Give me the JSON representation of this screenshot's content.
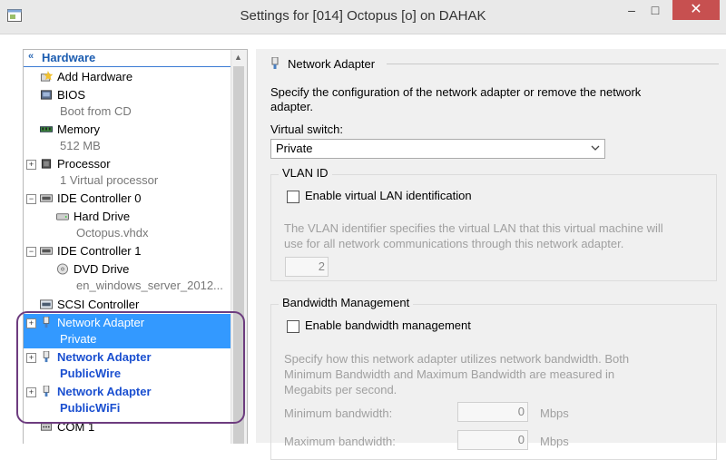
{
  "window": {
    "title": "Settings for [014] Octopus [o] on DAHAK",
    "minimize": "–",
    "maximize": "□",
    "close": "✕"
  },
  "tree": {
    "section_label": "Hardware",
    "items": [
      {
        "name": "Add Hardware",
        "sub": "",
        "icon": "add-hardware-icon"
      },
      {
        "name": "BIOS",
        "sub": "Boot from CD",
        "icon": "bios-icon"
      },
      {
        "name": "Memory",
        "sub": "512 MB",
        "icon": "memory-icon"
      },
      {
        "name": "Processor",
        "sub": "1 Virtual processor",
        "icon": "processor-icon"
      },
      {
        "name": "IDE Controller 0",
        "sub": "",
        "icon": "ide-controller-icon"
      },
      {
        "name": "Hard Drive",
        "sub": "Octopus.vhdx",
        "icon": "hard-drive-icon"
      },
      {
        "name": "IDE Controller 1",
        "sub": "",
        "icon": "ide-controller-icon"
      },
      {
        "name": "DVD Drive",
        "sub": "en_windows_server_2012...",
        "icon": "dvd-drive-icon"
      },
      {
        "name": "SCSI Controller",
        "sub": "",
        "icon": "scsi-controller-icon"
      },
      {
        "name": "Network Adapter",
        "sub": "Private",
        "icon": "network-adapter-icon"
      },
      {
        "name": "Network Adapter",
        "sub": "PublicWire",
        "icon": "network-adapter-icon"
      },
      {
        "name": "Network Adapter",
        "sub": "PublicWiFi",
        "icon": "network-adapter-icon"
      },
      {
        "name": "COM 1",
        "sub": "",
        "icon": "com-port-icon"
      }
    ]
  },
  "panel": {
    "title": "Network Adapter",
    "description": "Specify the configuration of the network adapter or remove the network adapter.",
    "virtual_switch_label": "Virtual switch:",
    "virtual_switch_value": "Private",
    "vlan": {
      "group_title": "VLAN ID",
      "checkbox_label": "Enable virtual LAN identification",
      "help": "The VLAN identifier specifies the virtual LAN that this virtual machine will use for all network communications through this network adapter.",
      "value": "2"
    },
    "bandwidth": {
      "group_title": "Bandwidth Management",
      "checkbox_label": "Enable bandwidth management",
      "help": "Specify how this network adapter utilizes network bandwidth. Both Minimum Bandwidth and Maximum Bandwidth are measured in Megabits per second.",
      "min_label": "Minimum bandwidth:",
      "min_value": "0",
      "min_unit": "Mbps",
      "max_label": "Maximum bandwidth:",
      "max_value": "0",
      "max_unit": "Mbps"
    }
  },
  "colors": {
    "selection": "#3399ff",
    "bold_link": "#1a4fd0",
    "highlight_ring": "#6d3c7f",
    "close_button": "#c75050"
  }
}
